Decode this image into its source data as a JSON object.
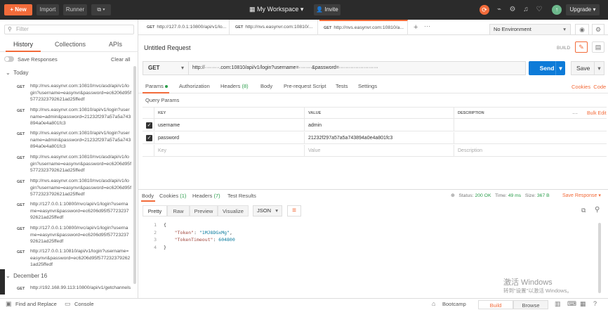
{
  "topbar": {
    "new_label": "New",
    "import_label": "Import",
    "runner_label": "Runner",
    "workspace_label": "My Workspace",
    "invite_label": "Invite",
    "upgrade_label": "Upgrade"
  },
  "sidebar": {
    "filter_placeholder": "Filter",
    "tabs": [
      "History",
      "Collections",
      "APIs"
    ],
    "save_responses_label": "Save Responses",
    "clear_all_label": "Clear all",
    "groups": [
      {
        "label": "Today"
      },
      {
        "label": "December 16"
      }
    ],
    "items": [
      {
        "method": "GET",
        "url": "http://nvs.easynvr.com:10810/nvc/asd/api/v1/login?username=easynvr&password=ec6206d95f5772323792621ad25ffedf"
      },
      {
        "method": "GET",
        "url": "http://nvs.easynvr.com:10810/api/v1/login?username=admin&password=21232f297a57a5a743894a0e4a801fc3"
      },
      {
        "method": "GET",
        "url": "http://nvs.easynvr.com:10810/api/v1/login?username=admin&password=21232f297a57a5a743894a0e4a801fc3"
      },
      {
        "method": "GET",
        "url": "http://nvs.easynvr.com:10810/nvc/asd/api/v1/login?username=easynvr&password=ec6206d95f5772323792621ad25ffedf"
      },
      {
        "method": "GET",
        "url": "http://nvs.easynvr.com:10810/nvc/asd/api/v1/login?username=easynvr&password=ec6206d95f5772323792621ad25ffedf"
      },
      {
        "method": "GET",
        "url": "http://127.0.0.1:10800/nvc/api/v1/login?username=easynvr&password=ec6206d95f5772323792621ad25ffedf"
      },
      {
        "method": "GET",
        "url": "http://127.0.0.1:10800/nvc/api/v1/login?username=easynvr&password=ec6206d95f5772323792621ad25ffedf"
      },
      {
        "method": "GET",
        "url": "http://127.0.0.1:10810/api/v1/login?username=easynvr&password=ec6206d95f5772323792621ad25ffedf"
      }
    ],
    "dec_item": {
      "method": "GET",
      "url": "http://192.168.99.113:10800/api/v1/getchannels"
    }
  },
  "request_tabs": [
    {
      "method": "GET",
      "label": "http://127.0.0.1:10800/api/v1/lo..."
    },
    {
      "method": "GET",
      "label": "http://nvs.easynvr.com:10810/..."
    },
    {
      "method": "GET",
      "label": "http://nvs.easynvr.com:10810/a..."
    }
  ],
  "environment": {
    "selected": "No Environment"
  },
  "request": {
    "title": "Untitled Request",
    "build_label": "BUILD",
    "method": "GET",
    "url": "http://·········.com:10810/api/v1/login?username=········&password=························",
    "send_label": "Send",
    "save_label": "Save"
  },
  "param_tabs": [
    {
      "label": "Params",
      "count": ""
    },
    {
      "label": "Authorization",
      "count": ""
    },
    {
      "label": "Headers",
      "count": "(8)"
    },
    {
      "label": "Body",
      "count": ""
    },
    {
      "label": "Pre-request Script",
      "count": ""
    },
    {
      "label": "Tests",
      "count": ""
    },
    {
      "label": "Settings",
      "count": ""
    }
  ],
  "cookies_label": "Cookies",
  "code_label": "Code",
  "query_params": {
    "title": "Query Params",
    "headers": {
      "key": "KEY",
      "value": "VALUE",
      "description": "DESCRIPTION"
    },
    "bulk_edit_label": "Bulk Edit",
    "rows": [
      {
        "key": "username",
        "value": "admin",
        "description": ""
      },
      {
        "key": "password",
        "value": "21232f297a57a5a743894a0e4a801fc3",
        "description": ""
      }
    ],
    "placeholder": {
      "key": "Key",
      "value": "Value",
      "description": "Description"
    }
  },
  "response": {
    "tabs": [
      {
        "label": "Body",
        "count": ""
      },
      {
        "label": "Cookies",
        "count": "(1)"
      },
      {
        "label": "Headers",
        "count": "(7)"
      },
      {
        "label": "Test Results",
        "count": ""
      }
    ],
    "status_label": "Status:",
    "status_value": "200 OK",
    "time_label": "Time:",
    "time_value": "49 ms",
    "size_label": "Size:",
    "size_value": "367 B",
    "save_response_label": "Save Response",
    "formats": [
      "Pretty",
      "Raw",
      "Preview",
      "Visualize"
    ],
    "json_label": "JSON",
    "lines": [
      "1",
      "2",
      "3",
      "4"
    ],
    "token_key": "\"Token\"",
    "token_value": "\"1MJ8DGxMg\"",
    "timeout_key": "\"TokenTimeout\"",
    "timeout_value": "604800"
  },
  "watermark": {
    "line1": "激活 Windows",
    "line2": "转到\"设置\"以激活 Windows。"
  },
  "footer": {
    "find_replace": "Find and Replace",
    "console": "Console",
    "bootcamp": "Bootcamp",
    "build": "Build",
    "browse": "Browse"
  },
  "colors": {
    "accent": "#f26b3a",
    "send": "#0d7bd8",
    "success": "#2a9d4a",
    "topbar": "#2b2b2b"
  }
}
